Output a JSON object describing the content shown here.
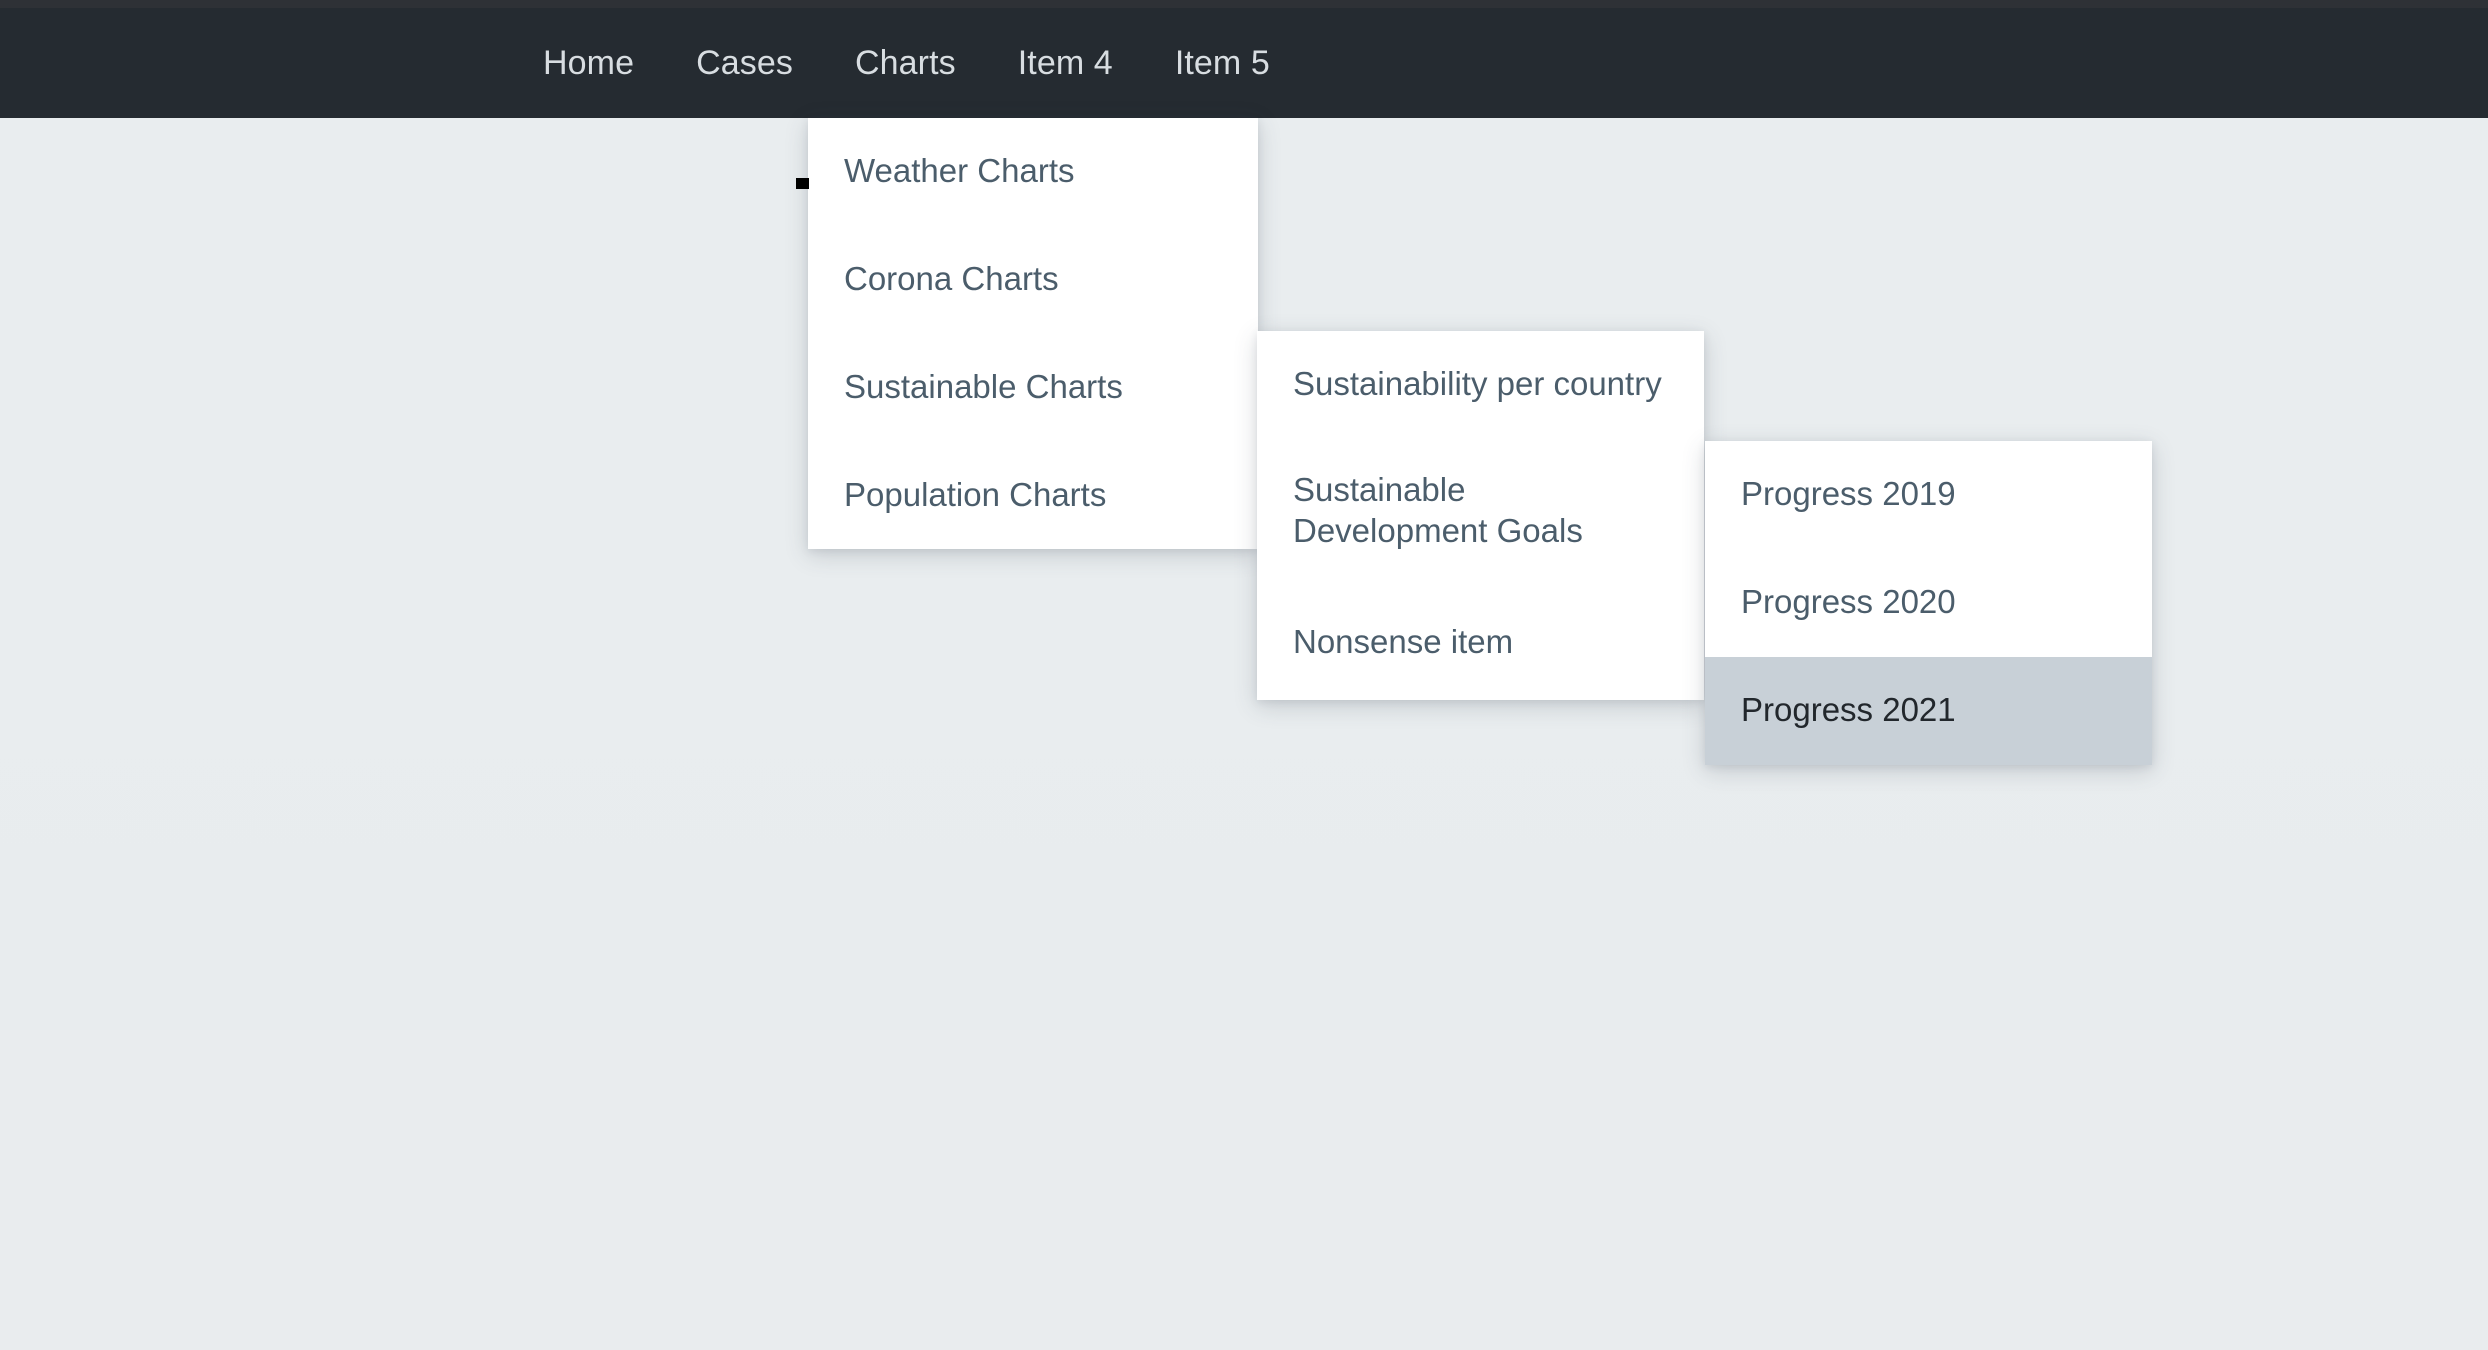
{
  "colors": {
    "navbar_bg": "#252b31",
    "top_strip": "#2e3136",
    "page_bg": "#e9edef",
    "panel_bg": "#ffffff",
    "menu_text": "#4b5d6b",
    "nav_text": "#d8dde1",
    "active_item_bg": "#c8d0d7",
    "active_item_text": "#22272c",
    "cursor_marker": "#000000"
  },
  "navbar": {
    "items": [
      {
        "label": "Home"
      },
      {
        "label": "Cases"
      },
      {
        "label": "Charts"
      },
      {
        "label": "Item 4"
      },
      {
        "label": "Item 5"
      }
    ]
  },
  "menus": {
    "charts_menu": {
      "items": [
        {
          "label": "Weather Charts"
        },
        {
          "label": "Corona Charts"
        },
        {
          "label": "Sustainable Charts"
        },
        {
          "label": "Population Charts"
        }
      ]
    },
    "sustainable_submenu": {
      "items": [
        {
          "label": "Sustainability per country"
        },
        {
          "label": "Sustainable Development Goals"
        },
        {
          "label": "Nonsense item"
        }
      ]
    },
    "sdg_submenu": {
      "items": [
        {
          "label": "Progress 2019"
        },
        {
          "label": "Progress 2020"
        },
        {
          "label": "Progress 2021"
        }
      ]
    }
  }
}
